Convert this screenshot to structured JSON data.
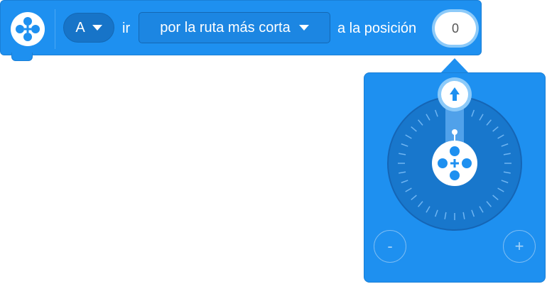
{
  "block": {
    "icon": "motor-icon",
    "port_value": "A",
    "text_go": "ir",
    "direction_value": "por la ruta más corta",
    "text_position": "a la posición",
    "position_value": "0"
  },
  "dial_popover": {
    "handle_icon": "arrow-up-icon",
    "center_icon": "motor-icon",
    "minus_label": "-",
    "plus_label": "+",
    "position_degrees": 0
  },
  "colors": {
    "block_blue": "#1e90f0",
    "dark_blue": "#1774c8",
    "dial_face": "#1877cc",
    "white": "#ffffff"
  }
}
